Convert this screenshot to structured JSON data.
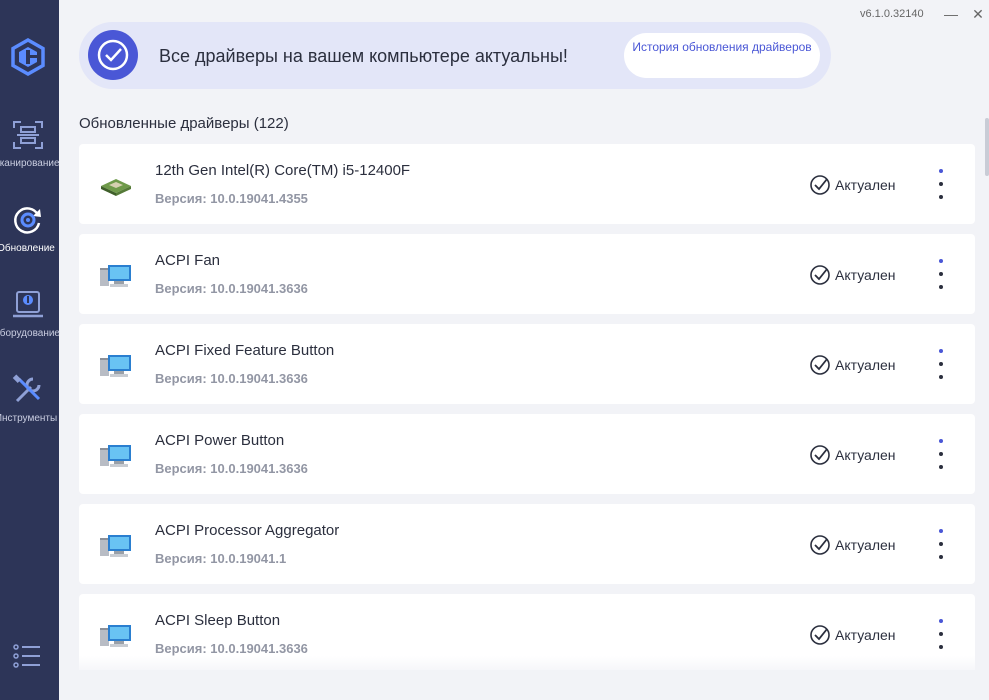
{
  "window": {
    "version": "v6.1.0.32140",
    "minimize_glyph": "—",
    "close_glyph": "✕"
  },
  "sidebar": {
    "logo": "app-logo",
    "items": [
      {
        "label": "Сканирование",
        "icon": "scan-icon",
        "active": false
      },
      {
        "label": "Обновление",
        "icon": "update-icon",
        "active": true
      },
      {
        "label": "Оборудование",
        "icon": "hardware-icon",
        "active": false
      },
      {
        "label": "Инструменты",
        "icon": "tools-icon",
        "active": false
      }
    ],
    "menu_icon": "menu-list-icon"
  },
  "banner": {
    "message": "Все драйверы на вашем компьютере актуальны!",
    "button_label": "История обновления драйверов"
  },
  "section": {
    "title": "Обновленные драйверы (122)"
  },
  "drivers": [
    {
      "name": "12th Gen Intel(R) Core(TM) i5-12400F",
      "version": "Версия: 10.0.19041.4355",
      "status": "Актуален",
      "icon": "cpu-chip-icon"
    },
    {
      "name": "ACPI Fan",
      "version": "Версия: 10.0.19041.3636",
      "status": "Актуален",
      "icon": "computer-icon"
    },
    {
      "name": "ACPI Fixed Feature Button",
      "version": "Версия: 10.0.19041.3636",
      "status": "Актуален",
      "icon": "computer-icon"
    },
    {
      "name": "ACPI Power Button",
      "version": "Версия: 10.0.19041.3636",
      "status": "Актуален",
      "icon": "computer-icon"
    },
    {
      "name": "ACPI Processor Aggregator",
      "version": "Версия: 10.0.19041.1",
      "status": "Актуален",
      "icon": "computer-icon"
    },
    {
      "name": "ACPI Sleep Button",
      "version": "Версия: 10.0.19041.3636",
      "status": "Актуален",
      "icon": "computer-icon"
    }
  ],
  "colors": {
    "sidebar": "#2d3558",
    "accent": "#4a57d6",
    "banner_bg": "#e3e6f8"
  }
}
